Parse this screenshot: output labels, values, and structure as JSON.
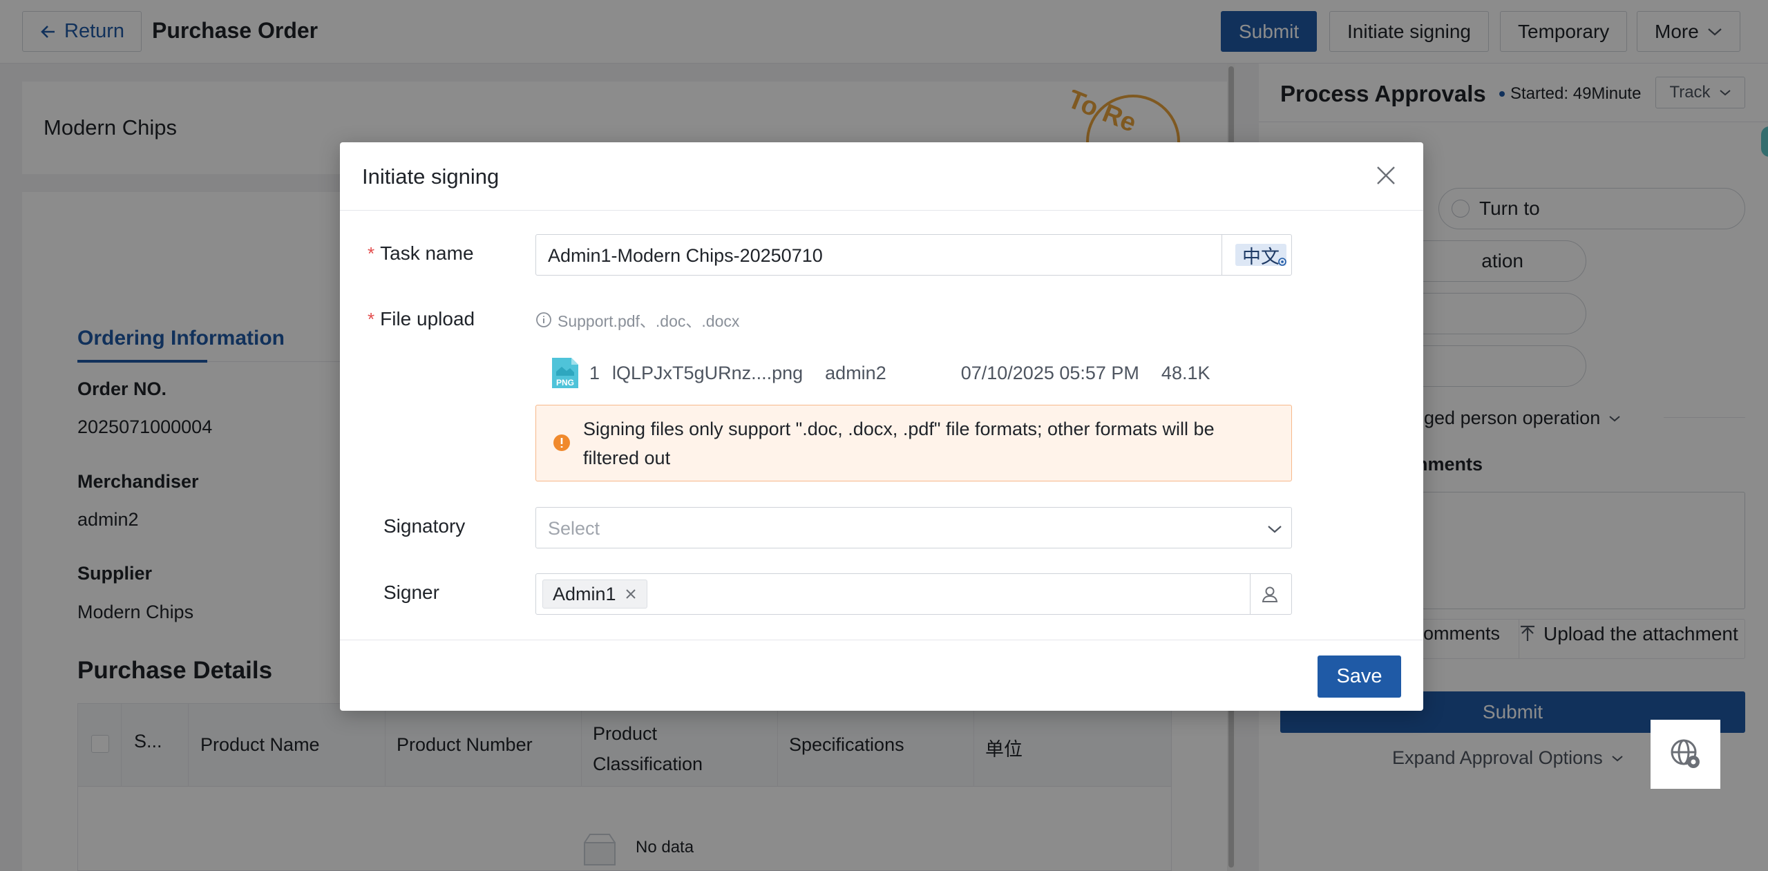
{
  "topbar": {
    "return_label": "Return",
    "title": "Purchase Order",
    "buttons": {
      "submit": "Submit",
      "initiate_signing": "Initiate signing",
      "temporary": "Temporary",
      "more": "More"
    }
  },
  "main": {
    "company": "Modern Chips",
    "stamp_text": "To Re",
    "section_tab": "Ordering Information",
    "fields": [
      {
        "label": "Order NO.",
        "value": "2025071000004"
      },
      {
        "label": "Merchandiser",
        "value": "admin2"
      },
      {
        "label": "Supplier",
        "value": "Modern Chips"
      }
    ],
    "details_title": "Purchase Details",
    "table_headers": [
      "S...",
      "Product Name",
      "Product Number",
      "Product Classification",
      "Specifications",
      "单位"
    ],
    "no_data": "No data"
  },
  "right": {
    "title": "Process Approvals",
    "started": "Started: 49Minute",
    "track": "Track",
    "turn_to": "Turn to",
    "ation": "ation",
    "privileged": "leged person operation",
    "comments_label": "nments",
    "add_comments": "omments",
    "upload_attachment": "Upload the attachment",
    "submit": "Submit",
    "expand": "Expand Approval Options"
  },
  "modal": {
    "title": "Initiate signing",
    "task_name_label": "Task name",
    "task_name_value": "Admin1-Modern Chips-20250710",
    "lang_badge": "中文",
    "file_upload_label": "File upload",
    "file_hint": "Support.pdf、.doc、.docx",
    "file": {
      "index": "1",
      "name": "lQLPJxT5gURnz....png",
      "uploader": "admin2",
      "datetime": "07/10/2025 05:57 PM",
      "size": "48.1K",
      "type_label": "PNG"
    },
    "warning": "Signing files only support \".doc, .docx, .pdf\" file formats; other formats will be filtered out",
    "signatory_label": "Signatory",
    "signatory_placeholder": "Select",
    "signer_label": "Signer",
    "signer_tag": "Admin1",
    "save": "Save"
  },
  "colors": {
    "primary": "#1f5aa6",
    "required": "#e34d4d",
    "warning_bg": "#fff3ea",
    "warning_border": "#f7b88a",
    "warning_icon": "#f0892d"
  }
}
